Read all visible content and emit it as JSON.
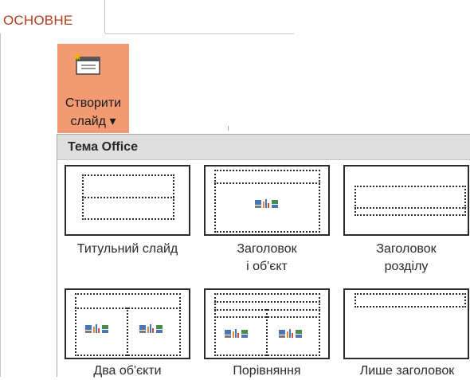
{
  "ribbon": {
    "tab_label": "ОСНОВНЕ",
    "new_slide_line1": "Створити",
    "new_slide_line2": "слайд ▾"
  },
  "gallery": {
    "title": "Тема Office",
    "layouts": [
      {
        "line1": "Титульний слайд",
        "line2": ""
      },
      {
        "line1": "Заголовок",
        "line2": "і  об'єкт"
      },
      {
        "line1": "Заголовок",
        "line2": "розділу"
      },
      {
        "line1": "Два об'єкти",
        "line2": ""
      },
      {
        "line1": "Порівняння",
        "line2": ""
      },
      {
        "line1": "Лише заголовок",
        "line2": ""
      }
    ]
  },
  "colors": {
    "tab_text": "#b33f22",
    "button_bg": "#f29a72",
    "header_bg": "#dedede"
  }
}
